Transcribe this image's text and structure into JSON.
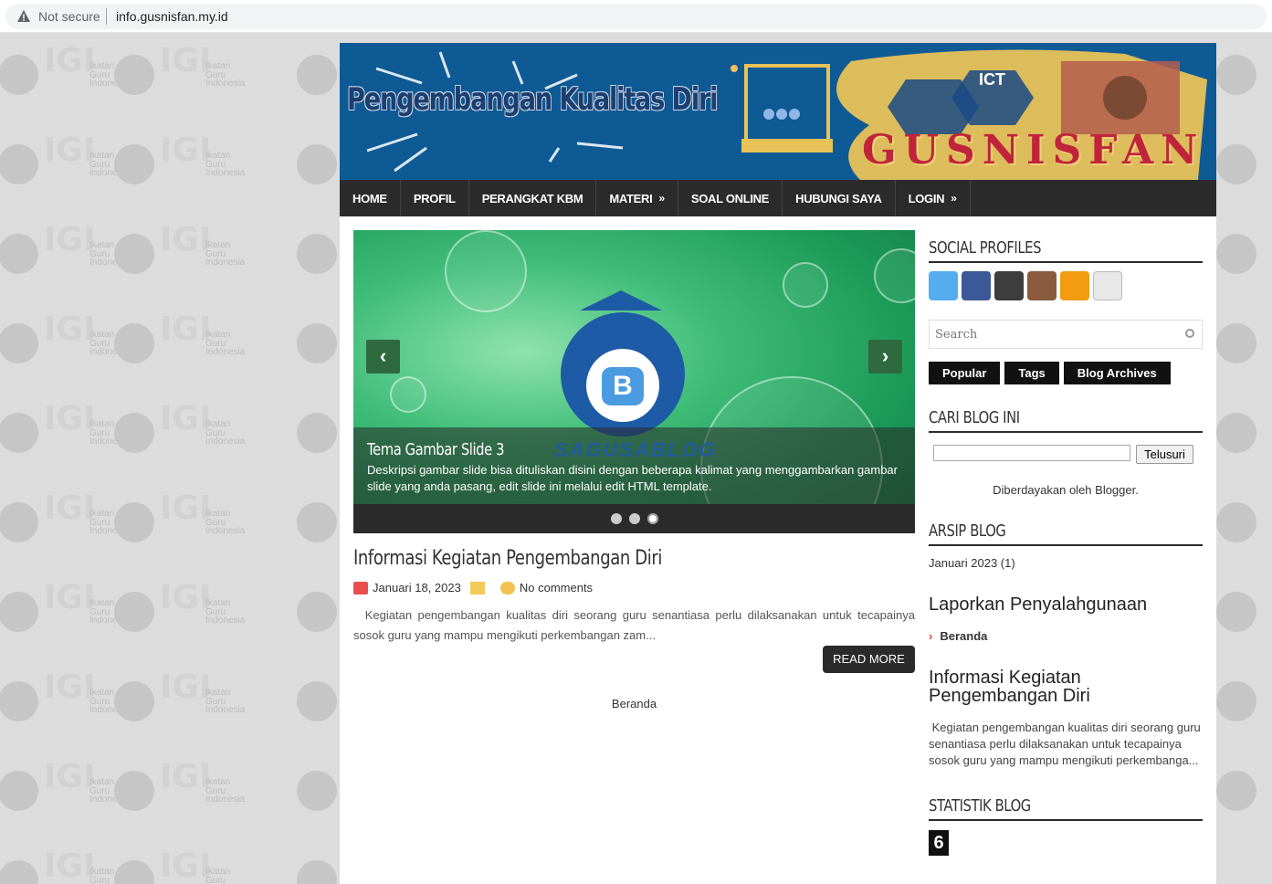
{
  "browser": {
    "security_label": "Not secure",
    "url": "info.gusnisfan.my.id"
  },
  "header": {
    "site_title": "Pengembangan Kualitas Diri",
    "brand": "GUSNISFAN",
    "ict": "ICT"
  },
  "nav": {
    "items": [
      {
        "label": "HOME",
        "arrow": ""
      },
      {
        "label": "PROFIL",
        "arrow": ""
      },
      {
        "label": "PERANGKAT KBM",
        "arrow": ""
      },
      {
        "label": "MATERI",
        "arrow": "»"
      },
      {
        "label": "SOAL ONLINE",
        "arrow": ""
      },
      {
        "label": "HUBUNGI SAYA",
        "arrow": ""
      },
      {
        "label": "LOGIN",
        "arrow": "»"
      }
    ]
  },
  "slider": {
    "title": "Tema Gambar Slide 3",
    "description": "Deskripsi gambar slide bisa dituliskan disini dengan beberapa kalimat yang menggambarkan gambar slide yang anda pasang, edit slide ini melalui edit HTML template.",
    "watermark": "SAGUSABLOG",
    "prev": "‹",
    "next": "›",
    "slide_count": 3,
    "active_slide": 3
  },
  "post": {
    "title": "Informasi Kegiatan Pengembangan Diri",
    "date": "Januari 18, 2023",
    "comments": "No comments",
    "excerpt": "Kegiatan pengembangan kualitas diri seorang guru senantiasa perlu dilaksanakan untuk tecapainya sosok guru yang mampu mengikuti perkembangan zam...",
    "read_more": "READ MORE",
    "pager": "Beranda"
  },
  "sidebar": {
    "social_title": "SOCIAL PROFILES",
    "social_icons": [
      "twitter-icon",
      "facebook-icon",
      "google-plus-icon",
      "instagram-icon",
      "rss-icon",
      "email-icon"
    ],
    "search_placeholder": "Search",
    "tabs": [
      "Popular",
      "Tags",
      "Blog Archives"
    ],
    "cari_title": "CARI BLOG INI",
    "cari_button": "Telusuri",
    "powered": "Diberdayakan oleh Blogger.",
    "arsip_title": "ARSIP BLOG",
    "arsip_item": "Januari 2023 (1)",
    "laporkan_title": "Laporkan Penyalahgunaan",
    "laporkan_link": "Beranda",
    "featured_title": "Informasi Kegiatan Pengembangan Diri",
    "featured_excerpt": "Kegiatan pengembangan kualitas diri seorang guru senantiasa perlu dilaksanakan untuk tecapainya sosok guru yang mampu mengikuti perkembanga...",
    "stat_title": "STATISTIK BLOG",
    "stat_value": "6"
  },
  "watermark": {
    "line1": "Ikatan",
    "line2": "Guru",
    "line3": "Indonesia",
    "logo": "IGI"
  },
  "colors": {
    "nav_bg": "#2b2b2b",
    "header_bg": "#0e5a95",
    "page_bg": "#dcdcdc"
  }
}
